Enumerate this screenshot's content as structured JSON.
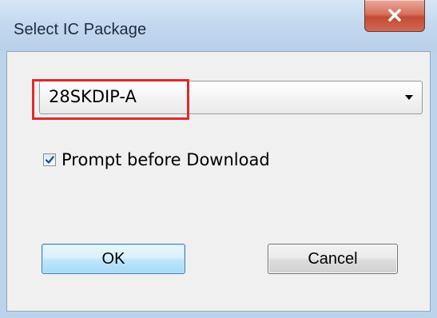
{
  "window": {
    "title": "Select IC Package",
    "close_icon": "close-icon"
  },
  "package_select": {
    "value": "28SKDIP-A",
    "arrow_icon": "chevron-down-icon",
    "highlight_color": "#e02a2a"
  },
  "prompt_checkbox": {
    "label": "Prompt before Download",
    "checked": true
  },
  "buttons": {
    "ok_label": "OK",
    "cancel_label": "Cancel"
  }
}
